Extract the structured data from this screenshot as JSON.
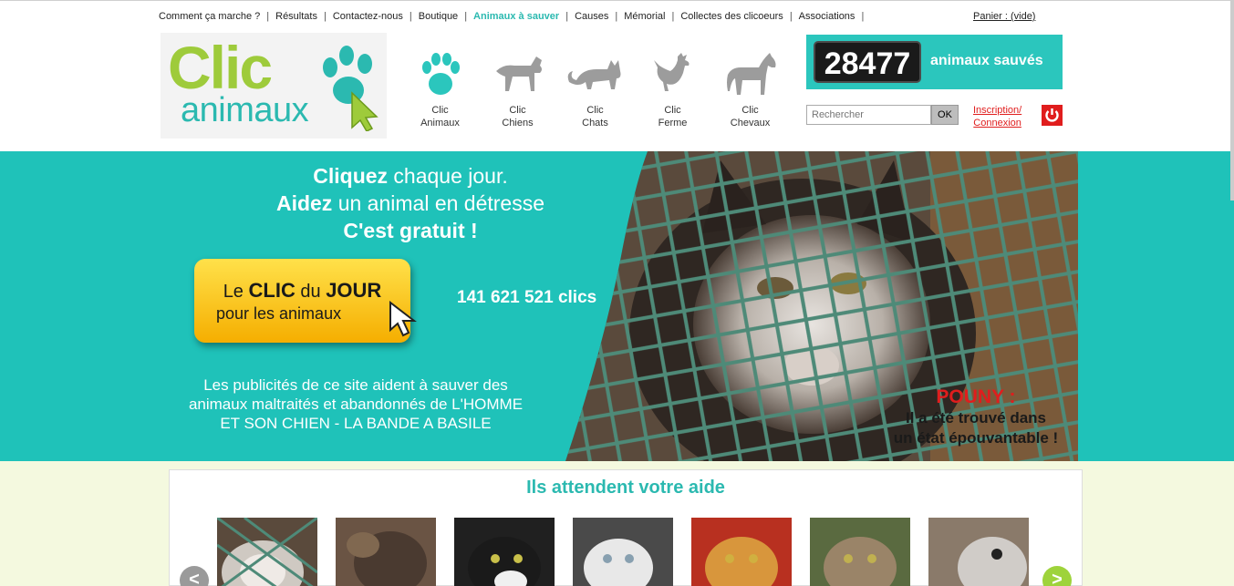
{
  "nav": {
    "items": [
      {
        "label": "Comment ça marche ?",
        "active": false
      },
      {
        "label": "Résultats",
        "active": false
      },
      {
        "label": "Contactez-nous",
        "active": false
      },
      {
        "label": "Boutique",
        "active": false
      },
      {
        "label": "Animaux à sauver",
        "active": true
      },
      {
        "label": "Causes",
        "active": false
      },
      {
        "label": "Mémorial",
        "active": false
      },
      {
        "label": "Collectes des clicoeurs",
        "active": false
      },
      {
        "label": "Associations",
        "active": false
      }
    ],
    "cart": "Panier : (vide)"
  },
  "logo": {
    "line1": "Clic",
    "line2": "animaux"
  },
  "categories": [
    {
      "line1": "Clic",
      "line2": "Animaux",
      "icon": "paw-icon"
    },
    {
      "line1": "Clic",
      "line2": "Chiens",
      "icon": "dog-icon"
    },
    {
      "line1": "Clic",
      "line2": "Chats",
      "icon": "cat-icon"
    },
    {
      "line1": "Clic",
      "line2": "Ferme",
      "icon": "rooster-icon"
    },
    {
      "line1": "Clic",
      "line2": "Chevaux",
      "icon": "horse-icon"
    }
  ],
  "counter": {
    "value": "28477",
    "label": "animaux sauvés"
  },
  "search": {
    "placeholder": "Rechercher",
    "button": "OK"
  },
  "login": {
    "line1": "Inscription/",
    "line2": "Connexion"
  },
  "hero": {
    "line1_bold": "Cliquez",
    "line1_rest": " chaque jour.",
    "line2_bold": "Aidez",
    "line2_rest": " un animal en détresse",
    "line3": "C'est gratuit !",
    "cta_le": "Le ",
    "cta_clic": "CLIC",
    "cta_du": " du ",
    "cta_jour": "JOUR",
    "cta_line2": "pour les animaux",
    "clics": "141 621 521 clics",
    "ads_text": "Les publicités de ce site aident à sauver des animaux maltraités et abandonnés de L'HOMME ET SON CHIEN - LA BANDE A BASILE",
    "caption_name": "POUNY :",
    "caption_l1": "Il a été trouvé dans",
    "caption_l2": "un état épouvantable !"
  },
  "waiting": {
    "title": "Ils attendent votre aide",
    "prev": "<",
    "next": ">"
  },
  "colors": {
    "teal": "#1fc2b9",
    "green": "#9ecb3b",
    "red": "#e01d1d",
    "yellow": "#f5ae00"
  }
}
